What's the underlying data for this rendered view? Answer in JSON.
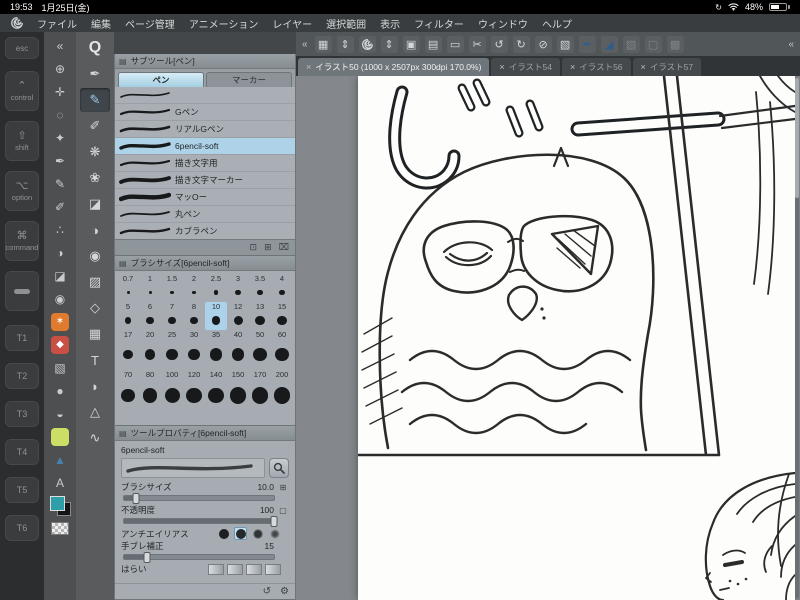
{
  "colors": {
    "accent": "#a9d0e6",
    "selection": "#aed3e8",
    "panel_bg": "#a6acb1",
    "canvas_bg": "#84888c",
    "ink": "#2b2b2b",
    "tab_active_bg": "#6e767b",
    "main_color": "#2e9ea8"
  },
  "status_bar": {
    "time": "19:53",
    "date": "1月25日(金)",
    "battery_percent": "48%"
  },
  "menu_bar": {
    "items": [
      "ファイル",
      "編集",
      "ページ管理",
      "アニメーション",
      "レイヤー",
      "選択範囲",
      "表示",
      "フィルター",
      "ウィンドウ",
      "ヘルプ"
    ]
  },
  "edge_keyboard": {
    "keys": [
      {
        "kind": "esc",
        "label": "esc",
        "glyph": "",
        "name": "esc"
      },
      {
        "kind": "mod",
        "label": "control",
        "glyph": "⌃",
        "name": "control"
      },
      {
        "kind": "mod",
        "label": "shift",
        "glyph": "⇧",
        "name": "shift"
      },
      {
        "kind": "mod",
        "label": "option",
        "glyph": "⌥",
        "name": "option"
      },
      {
        "kind": "mod",
        "label": "command",
        "glyph": "⌘",
        "name": "command"
      },
      {
        "kind": "space",
        "label": "",
        "glyph": "",
        "name": "space"
      },
      {
        "kind": "t",
        "label": "T1",
        "glyph": "",
        "name": "t1"
      },
      {
        "kind": "t",
        "label": "T2",
        "glyph": "",
        "name": "t2"
      },
      {
        "kind": "t",
        "label": "T3",
        "glyph": "",
        "name": "t3"
      },
      {
        "kind": "t",
        "label": "T4",
        "glyph": "",
        "name": "t4"
      },
      {
        "kind": "t",
        "label": "T5",
        "glyph": "",
        "name": "t5"
      },
      {
        "kind": "t",
        "label": "T6",
        "glyph": "",
        "name": "t6"
      }
    ]
  },
  "tool_column_1": {
    "items": [
      {
        "glyph": "«",
        "name": "collapse-left-icon"
      },
      {
        "glyph": "⊕",
        "name": "zoom-tool"
      },
      {
        "glyph": "✛",
        "name": "move-tool"
      },
      {
        "glyph": "◌",
        "name": "selection-tool"
      },
      {
        "glyph": "✦",
        "name": "auto-select-tool"
      },
      {
        "glyph": "✒",
        "name": "pen-tool"
      },
      {
        "glyph": "✎",
        "name": "pencil-tool"
      },
      {
        "glyph": "✐",
        "name": "brush-tool"
      },
      {
        "glyph": "∴",
        "name": "airbrush-tool"
      },
      {
        "glyph": "◑",
        "name": "blend-tool"
      },
      {
        "glyph": "◪",
        "name": "eraser-tool"
      },
      {
        "glyph": "◉",
        "name": "fill-tool"
      },
      {
        "type": "tile",
        "bg": "#e07a2e",
        "glyph": "✶",
        "name": "clip-studio-orange-icon"
      },
      {
        "type": "tile",
        "bg": "#c94f44",
        "glyph": "◆",
        "name": "app-red-icon"
      },
      {
        "glyph": "▧",
        "name": "material-icon"
      },
      {
        "glyph": "●",
        "name": "sphere-icon"
      },
      {
        "glyph": "◒",
        "name": "droplet-icon"
      },
      {
        "type": "tile",
        "bg": "#cdde67",
        "glyph": "",
        "name": "sub-color-swatch"
      },
      {
        "glyph": "▲",
        "fg": "#4a7fae",
        "name": "triangle-icon"
      },
      {
        "glyph": "A",
        "name": "text-icon"
      },
      {
        "type": "colorpair",
        "name": "main-color-swatch",
        "main": "#2e9ea8",
        "sub": "#151515"
      },
      {
        "type": "checker",
        "name": "transparent-swatch"
      }
    ]
  },
  "tool_column_2": {
    "items": [
      {
        "glyph": "Q",
        "name": "q-zoom-icon",
        "big": true
      },
      {
        "glyph": "✒",
        "name": "pen-group-icon"
      },
      {
        "glyph": "✎",
        "name": "pencil-group-icon",
        "selected": true
      },
      {
        "glyph": "✐",
        "name": "brush-group-icon"
      },
      {
        "glyph": "❋",
        "name": "airbrush-group-icon"
      },
      {
        "glyph": "❀",
        "name": "decoration-group-icon"
      },
      {
        "glyph": "◪",
        "name": "eraser-group-icon"
      },
      {
        "glyph": "◑",
        "name": "blend-group-icon"
      },
      {
        "glyph": "◉",
        "name": "fill-group-icon"
      },
      {
        "glyph": "▨",
        "name": "gradient-group-icon"
      },
      {
        "glyph": "◇",
        "name": "figure-group-icon"
      },
      {
        "glyph": "▦",
        "name": "frame-group-icon"
      },
      {
        "glyph": "T",
        "name": "text-group-icon"
      },
      {
        "glyph": "◗",
        "name": "balloon-group-icon"
      },
      {
        "glyph": "△",
        "name": "ruler-group-icon"
      },
      {
        "glyph": "∿",
        "name": "correction-group-icon"
      }
    ]
  },
  "command_bar": {
    "collapse_left": "«",
    "collapse_right": "«",
    "icons": [
      {
        "glyph": "▦",
        "name": "dock-icon"
      },
      {
        "glyph": "⇕",
        "name": "stepper-icon"
      },
      {
        "type": "spiral",
        "name": "clip-studio-spiral-icon"
      },
      {
        "glyph": "⇕",
        "name": "stepper-icon-2"
      },
      {
        "glyph": "▣",
        "name": "new-canvas-icon"
      },
      {
        "glyph": "▤",
        "name": "page-manager-icon"
      },
      {
        "glyph": "▭",
        "name": "canvas-size-icon"
      },
      {
        "glyph": "✂",
        "name": "cut-icon"
      },
      {
        "glyph": "↺",
        "name": "undo-icon"
      },
      {
        "glyph": "↻",
        "name": "redo-icon"
      },
      {
        "glyph": "⊘",
        "name": "clear-icon"
      },
      {
        "glyph": "▧",
        "name": "selection-launcher-icon"
      },
      {
        "glyph": "✒",
        "color": "#2d5d8e",
        "name": "pen-ruler-icon"
      },
      {
        "glyph": "◢",
        "color": "#2d5d8e",
        "name": "perspective-icon"
      },
      {
        "glyph": "▨",
        "dim": true,
        "name": "grid-off-icon"
      },
      {
        "glyph": "▢",
        "dim": true,
        "name": "material-off-icon"
      },
      {
        "glyph": "▩",
        "dim": true,
        "name": "snap-off-icon"
      }
    ]
  },
  "canvas_tabs": [
    {
      "label": "イラスト50 (1000 x 2507px 300dpi 170.0%)",
      "active": true
    },
    {
      "label": "イラスト54",
      "active": false
    },
    {
      "label": "イラスト56",
      "active": false
    },
    {
      "label": "イラスト57",
      "active": false
    }
  ],
  "subtool_panel": {
    "title": "サブツール[ペン]",
    "tabs": [
      {
        "label": "ペン",
        "selected": true
      },
      {
        "label": "マーカー",
        "selected": false
      }
    ],
    "items": [
      {
        "name": "",
        "weight": 1.6
      },
      {
        "name": "Gペン",
        "weight": 2.2
      },
      {
        "name": "リアルGペン",
        "weight": 2.6
      },
      {
        "name": "6pencil-soft",
        "weight": 3.4,
        "selected": true
      },
      {
        "name": "描き文字用",
        "weight": 2.2
      },
      {
        "name": "描き文字マーカー",
        "weight": 3.8
      },
      {
        "name": "マッOー",
        "weight": 4.4
      },
      {
        "name": "丸ペン",
        "weight": 1.8
      },
      {
        "name": "カブラペン",
        "weight": 2.4
      }
    ],
    "footer_icons": [
      {
        "glyph": "⊡",
        "name": "lock-icon"
      },
      {
        "glyph": "⊞",
        "name": "add-subtool-icon"
      },
      {
        "glyph": "⌧",
        "name": "delete-subtool-icon"
      }
    ]
  },
  "brush_size_panel": {
    "title": "ブラシサイズ[6pencil-soft]",
    "selected": 10,
    "rows": [
      [
        0.7,
        1,
        1.5,
        2,
        2.5,
        3,
        3.5,
        4
      ],
      [
        5,
        6,
        7,
        8,
        10,
        12,
        13,
        15
      ],
      [
        17,
        20,
        25,
        30,
        35,
        40,
        50,
        60
      ],
      [
        70,
        80,
        100,
        120,
        140,
        150,
        170,
        200
      ]
    ]
  },
  "tool_property_panel": {
    "title": "ツールプロパティ[6pencil-soft]",
    "tool_name": "6pencil-soft",
    "properties": [
      {
        "type": "slider",
        "label": "ブラシサイズ",
        "value": "10.0",
        "fill": 8,
        "unit_icon": "⊞"
      },
      {
        "type": "slider",
        "label": "不透明度",
        "value": "100",
        "fill": 100,
        "unit_icon": "▢"
      },
      {
        "type": "aa",
        "label": "アンチエイリアス",
        "selected": 1,
        "count": 4
      },
      {
        "type": "slider",
        "label": "手ブレ補正",
        "value": "15",
        "fill": 15,
        "unit_icon": ""
      },
      {
        "type": "boxes",
        "label": "はらい",
        "count": 4
      }
    ],
    "footer_icons": [
      {
        "glyph": "↺",
        "name": "reset-all-icon"
      },
      {
        "glyph": "⚙",
        "name": "detail-settings-icon"
      }
    ]
  }
}
